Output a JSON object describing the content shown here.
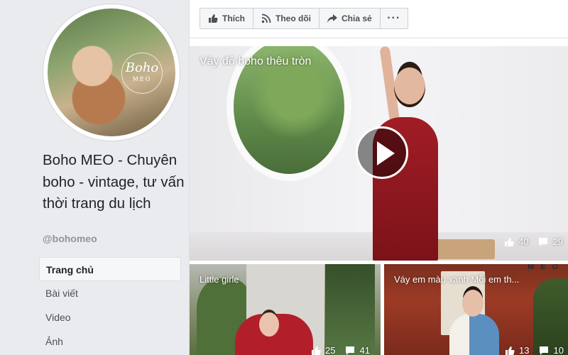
{
  "page": {
    "name": "Boho MEO - Chuyên boho - vintage, tư vấn thời trang du lịch",
    "handle": "@bohomeo",
    "avatar_logo": {
      "line1": "Boho",
      "line2": "MEO"
    }
  },
  "nav": {
    "items": [
      {
        "label": "Trang chủ",
        "active": true
      },
      {
        "label": "Bài viết"
      },
      {
        "label": "Video"
      },
      {
        "label": "Ảnh"
      }
    ]
  },
  "actions": {
    "like": {
      "label": "Thích",
      "icon": "thumbs-up-icon"
    },
    "follow": {
      "label": "Theo dõi",
      "icon": "rss-icon"
    },
    "share": {
      "label": "Chia sẻ",
      "icon": "share-arrow-icon"
    },
    "more": {
      "label": "···",
      "icon": "more-icon"
    }
  },
  "featured_video": {
    "title": "Váy đỏ boho thêu tròn",
    "likes": "40",
    "comments": "29"
  },
  "videos": [
    {
      "title": "Little girle",
      "likes": "25",
      "comments": "41"
    },
    {
      "title": "Váy em màu xanh Mỗi em th...",
      "likes": "13",
      "comments": "10",
      "watermark": "M E O"
    }
  ],
  "colors": {
    "page_bg": "#e9ebee",
    "text_dark": "#1d2129",
    "text_muted": "#90949c",
    "button_bg": "#f5f6f7",
    "button_border": "#ccd0d5"
  }
}
